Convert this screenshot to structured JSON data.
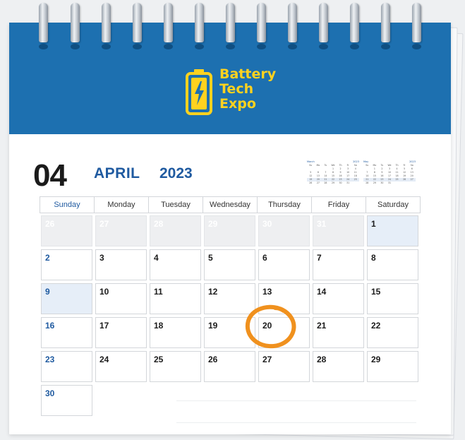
{
  "brand": {
    "line1": "Battery",
    "line2": "Tech",
    "line3": "Expo",
    "color": "#ffd21f",
    "header_color": "#1d70b0"
  },
  "month": {
    "number": "04",
    "name": "APRIL",
    "year": "2023"
  },
  "mini_calendars": [
    {
      "label": "March",
      "year": "2023",
      "weekdays": [
        "Su",
        "Mo",
        "Tu",
        "We",
        "Th",
        "Fr",
        "Sa"
      ],
      "days": [
        "",
        "",
        "",
        "1",
        "2",
        "3",
        "4",
        "5",
        "6",
        "7",
        "8",
        "9",
        "10",
        "11",
        "12",
        "13",
        "14",
        "15",
        "16",
        "17",
        "18",
        "19",
        "20",
        "21",
        "22",
        "23",
        "24",
        "25",
        "26",
        "27",
        "28",
        "29",
        "30",
        "31",
        ""
      ]
    },
    {
      "label": "May",
      "year": "2023",
      "weekdays": [
        "Su",
        "Mo",
        "Tu",
        "We",
        "Th",
        "Fr",
        "Sa"
      ],
      "days": [
        "",
        "1",
        "2",
        "3",
        "4",
        "5",
        "6",
        "7",
        "8",
        "9",
        "10",
        "11",
        "12",
        "13",
        "14",
        "15",
        "16",
        "17",
        "18",
        "19",
        "20",
        "21",
        "22",
        "23",
        "24",
        "25",
        "26",
        "27",
        "28",
        "29",
        "30",
        "31",
        "",
        "",
        ""
      ]
    }
  ],
  "weekdays": [
    "Sunday",
    "Monday",
    "Tuesday",
    "Wednesday",
    "Thursday",
    "Friday",
    "Saturday"
  ],
  "weeks": [
    [
      {
        "d": "26",
        "prev": true
      },
      {
        "d": "27",
        "prev": true
      },
      {
        "d": "28",
        "prev": true
      },
      {
        "d": "29",
        "prev": true
      },
      {
        "d": "30",
        "prev": true
      },
      {
        "d": "31",
        "prev": true
      },
      {
        "d": "1",
        "tint": true
      }
    ],
    [
      {
        "d": "2"
      },
      {
        "d": "3"
      },
      {
        "d": "4"
      },
      {
        "d": "5"
      },
      {
        "d": "6"
      },
      {
        "d": "7"
      },
      {
        "d": "8"
      }
    ],
    [
      {
        "d": "9",
        "tint": true
      },
      {
        "d": "10"
      },
      {
        "d": "11"
      },
      {
        "d": "12"
      },
      {
        "d": "13"
      },
      {
        "d": "14"
      },
      {
        "d": "15"
      }
    ],
    [
      {
        "d": "16"
      },
      {
        "d": "17"
      },
      {
        "d": "18"
      },
      {
        "d": "19"
      },
      {
        "d": "20",
        "circled": true
      },
      {
        "d": "21"
      },
      {
        "d": "22"
      }
    ],
    [
      {
        "d": "23"
      },
      {
        "d": "24"
      },
      {
        "d": "25"
      },
      {
        "d": "26"
      },
      {
        "d": "27"
      },
      {
        "d": "28"
      },
      {
        "d": "29"
      }
    ],
    [
      {
        "d": "30"
      }
    ]
  ],
  "colors": {
    "accent_blue": "#1f5aa0",
    "circle_orange": "#f0911e",
    "tint": "#e6eef8"
  }
}
